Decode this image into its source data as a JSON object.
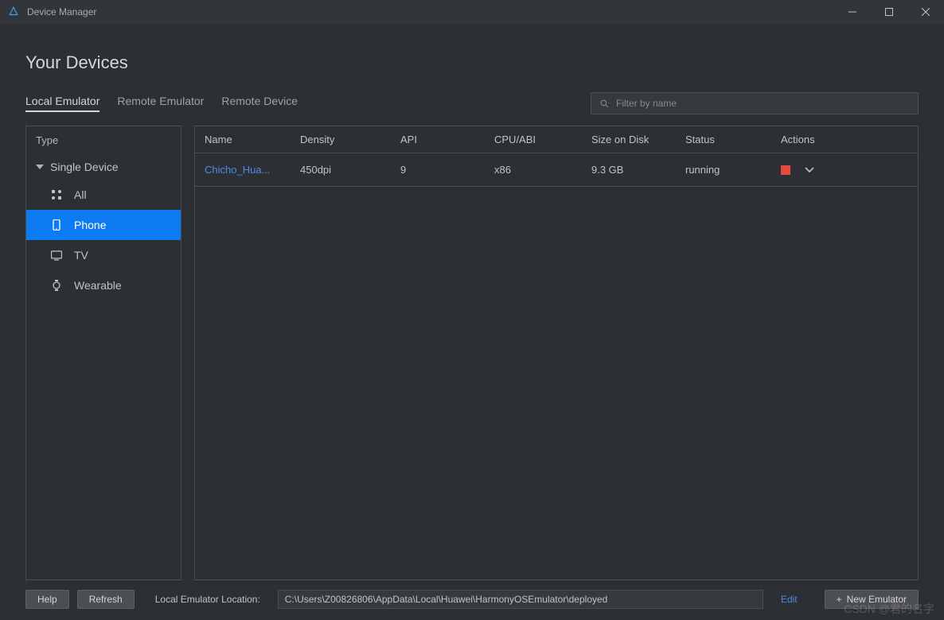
{
  "window": {
    "title": "Device Manager"
  },
  "page": {
    "title": "Your Devices"
  },
  "tabs": {
    "local": "Local Emulator",
    "remote_emu": "Remote Emulator",
    "remote_dev": "Remote Device"
  },
  "filter": {
    "placeholder": "Filter by name"
  },
  "sidebar": {
    "header": "Type",
    "parent": "Single Device",
    "items": {
      "all": "All",
      "phone": "Phone",
      "tv": "TV",
      "wearable": "Wearable"
    }
  },
  "table": {
    "headers": {
      "name": "Name",
      "density": "Density",
      "api": "API",
      "cpu": "CPU/ABI",
      "size": "Size on Disk",
      "status": "Status",
      "actions": "Actions"
    },
    "row0": {
      "name": "Chicho_Hua...",
      "density": "450dpi",
      "api": "9",
      "cpu": "x86",
      "size": "9.3 GB",
      "status": "running"
    }
  },
  "footer": {
    "help": "Help",
    "refresh": "Refresh",
    "location_label": "Local Emulator Location:",
    "location_value": "C:\\Users\\Z00826806\\AppData\\Local\\Huawei\\HarmonyOSEmulator\\deployed",
    "edit": "Edit",
    "new_emulator": "New Emulator"
  },
  "watermark": "CSDN @君的名字"
}
